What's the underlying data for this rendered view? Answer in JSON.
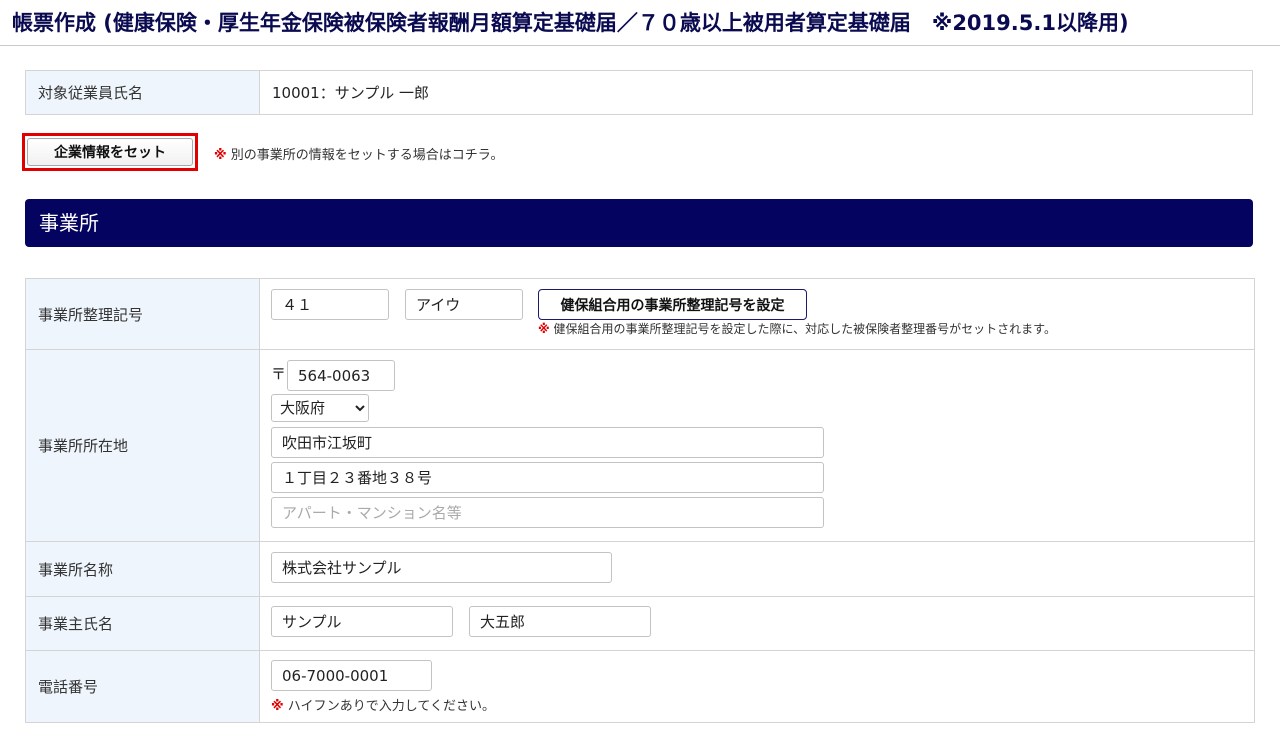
{
  "page_title": "帳票作成 (健康保険・厚生年金保険被保険者報酬月額算定基礎届／７０歳以上被用者算定基礎届　※2019.5.1以降用)",
  "employee": {
    "label": "対象従業員氏名",
    "value": "10001：サンプル 一郎"
  },
  "company_set": {
    "button_label": "企業情報をセット",
    "note_mark": "※",
    "note_text": "別の事業所の情報をセットする場合はコチラ。"
  },
  "section_title": "事業所",
  "office": {
    "code": {
      "label": "事業所整理記号",
      "value1": "４１",
      "value2": "アイウ",
      "button_label": "健保組合用の事業所整理記号を設定",
      "note_mark": "※",
      "note_text": "健保組合用の事業所整理記号を設定した際に、対応した被保険者整理番号がセットされます。"
    },
    "address": {
      "label": "事業所所在地",
      "postal_mark": "〒",
      "postal_code": "564-0063",
      "prefecture": "大阪府",
      "city": "吹田市江坂町",
      "street": "１丁目２３番地３８号",
      "building_placeholder": "アパート・マンション名等",
      "building_value": ""
    },
    "name": {
      "label": "事業所名称",
      "value": "株式会社サンプル"
    },
    "owner": {
      "label": "事業主氏名",
      "last_name": "サンプル",
      "first_name": "大五郎"
    },
    "phone": {
      "label": "電話番号",
      "value": "06-7000-0001",
      "note_mark": "※",
      "note_text": "ハイフンありで入力してください。"
    }
  },
  "colors": {
    "header_navy": "#040460",
    "label_bg": "#eef5fc",
    "highlight_red": "#e00000"
  }
}
